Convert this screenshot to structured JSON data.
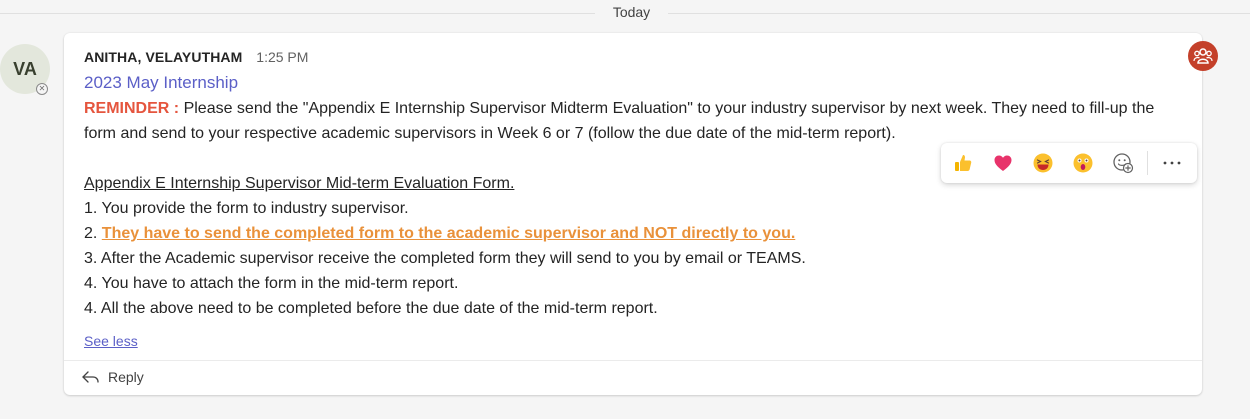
{
  "divider": {
    "label": "Today"
  },
  "avatar": {
    "initials": "VA"
  },
  "message": {
    "author": "ANITHA, VELAYUTHAM",
    "time": "1:25 PM",
    "subject": "2023 May Internship",
    "reminder_label": "REMINDER :",
    "reminder_text": "Please send the \"Appendix E Internship Supervisor Midterm Evaluation\" to your industry supervisor by next week. They need to fill-up the form and send to your respective academic supervisors in Week 6 or 7 (follow the due date of the mid-term report).",
    "form_title": "Appendix E Internship Supervisor Mid-term Evaluation Form.",
    "steps": [
      {
        "num": "1.",
        "text": "You provide the form to industry supervisor."
      },
      {
        "num": "2.",
        "text": "They have to send the completed form to the academic supervisor and NOT directly to you."
      },
      {
        "num": "3.",
        "text": "After the Academic supervisor receive the completed form they will send to you by email or TEAMS."
      },
      {
        "num": "4.",
        "text": "You have to attach the form in the mid-term report."
      },
      {
        "num": "4.",
        "text": "All the above need to be completed before the due date of the mid-term report."
      }
    ],
    "see_less": "See less",
    "reply": "Reply"
  },
  "reactions": [
    "like-icon",
    "heart-icon",
    "laugh-icon",
    "surprised-icon",
    "add-reaction-icon",
    "more-options-icon"
  ],
  "colors": {
    "accent": "#5b5fc7",
    "reminder": "#e5553e",
    "highlight": "#e9913a",
    "app_icon": "#c4402a"
  }
}
